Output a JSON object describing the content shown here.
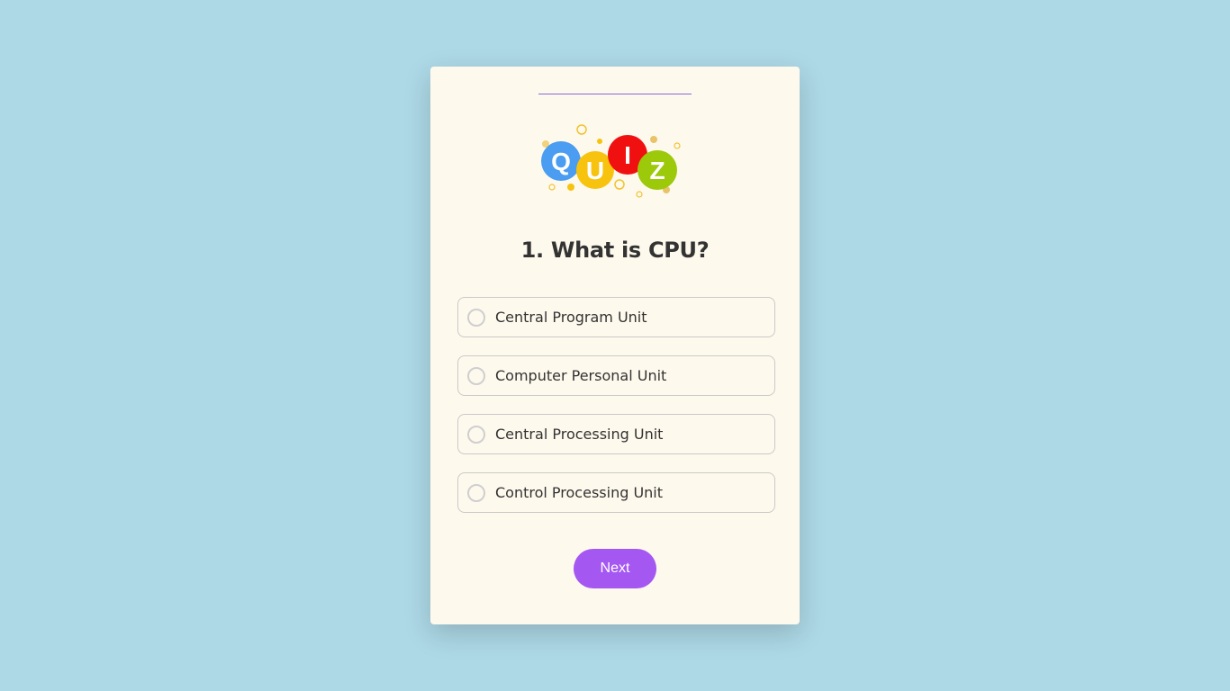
{
  "quiz": {
    "logo_letters": [
      "Q",
      "U",
      "I",
      "Z"
    ],
    "question": "1. What is CPU?",
    "options": [
      {
        "label": "Central Program Unit",
        "selected": false
      },
      {
        "label": "Computer Personal Unit",
        "selected": false
      },
      {
        "label": "Central Processing Unit",
        "selected": false
      },
      {
        "label": "Control Processing Unit",
        "selected": false
      }
    ],
    "next_label": "Next"
  },
  "colors": {
    "background": "#add8e6",
    "card": "#fef9ed",
    "accent": "#a557f2",
    "logo_q": "#4a9df0",
    "logo_u": "#f7c30e",
    "logo_i": "#f01010",
    "logo_z": "#9dc90b"
  }
}
